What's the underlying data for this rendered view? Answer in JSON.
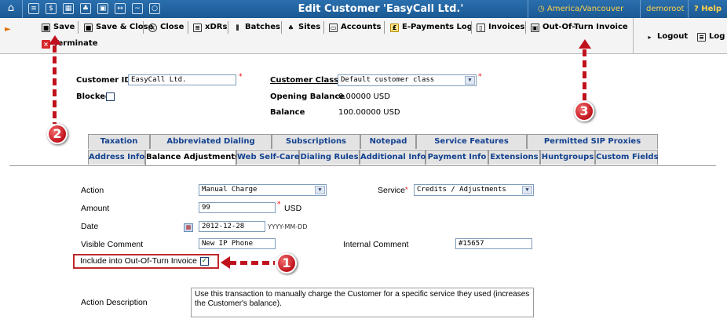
{
  "window": {
    "title": "Edit Customer 'EasyCall Ltd.'",
    "timezone": "America/Vancouver",
    "user": "demoroot",
    "help": "Help"
  },
  "toolbar": {
    "save": "Save",
    "save_close": "Save & Close",
    "close": "Close",
    "xdrs": "xDRs",
    "batches": "Batches",
    "sites": "Sites",
    "accounts": "Accounts",
    "epayments": "E-Payments Log",
    "invoices": "Invoices",
    "oot_invoice": "Out-Of-Turn Invoice",
    "logout": "Logout",
    "log": "Log",
    "terminate": "Terminate"
  },
  "customer": {
    "id_label": "Customer ID",
    "id_value": "EasyCall Ltd.",
    "blocked_label": "Blocked",
    "class_label": "Customer Class",
    "class_value": "Default customer class",
    "opening_balance_label": "Opening Balance",
    "opening_balance_value": "0.00000 USD",
    "balance_label": "Balance",
    "balance_value": "100.00000 USD"
  },
  "tabs_row1": [
    "Taxation",
    "Abbreviated Dialing",
    "Subscriptions",
    "Notepad",
    "Service Features",
    "Permitted SIP Proxies"
  ],
  "tabs_row2": [
    "Address Info",
    "Balance Adjustments",
    "Web Self-Care",
    "Dialing Rules",
    "Additional Info",
    "Payment Info",
    "Extensions",
    "Huntgroups",
    "Custom Fields"
  ],
  "form": {
    "action_label": "Action",
    "action_value": "Manual Charge",
    "service_label": "Service",
    "service_value": "Credits / Adjustments",
    "amount_label": "Amount",
    "amount_value": "99",
    "amount_currency": "USD",
    "date_label": "Date",
    "date_value": "2012-12-28",
    "date_hint": "YYYY-MM-DD",
    "visible_comment_label": "Visible Comment",
    "visible_comment_value": "New IP Phone",
    "internal_comment_label": "Internal Comment",
    "internal_comment_value": "#15657",
    "include_oot_label": "Include into Out-Of-Turn Invoice",
    "include_oot_checked": true,
    "action_description_label": "Action Description",
    "action_description_value": "Use this transaction to manually charge the Customer for a specific service they used (increases the Customer's balance)."
  },
  "callouts": [
    "1",
    "2",
    "3"
  ],
  "icons": [
    "home-icon",
    "calendar-icon",
    "checkbox-icon"
  ],
  "colors": {
    "header_blue": "#1b5a93",
    "tab_text": "#13418f",
    "callout_red": "#c0121c",
    "accent_yellow": "#ffd24a"
  }
}
